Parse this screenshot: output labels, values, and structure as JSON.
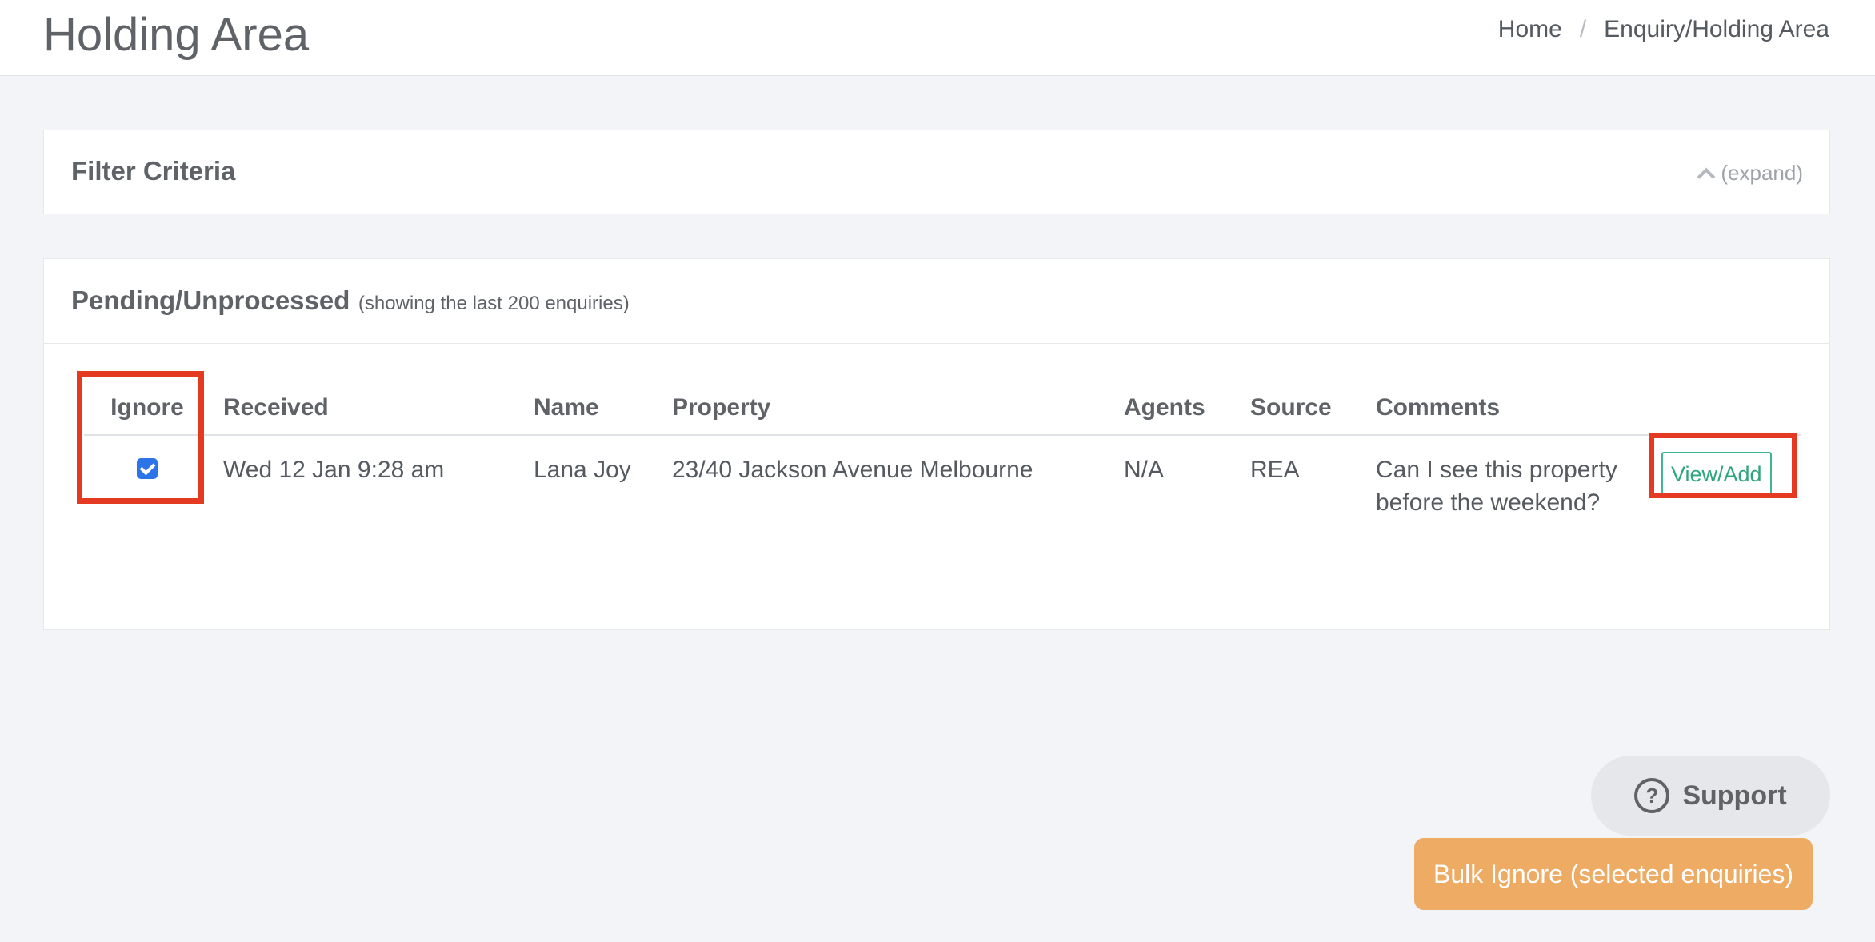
{
  "header": {
    "title": "Holding Area",
    "breadcrumb": [
      "Home",
      "/",
      "Enquiry/Holding Area"
    ]
  },
  "filter": {
    "title": "Filter Criteria",
    "expand_label": "(expand)"
  },
  "pending": {
    "title": "Pending/Unprocessed",
    "subtitle": "(showing the last 200 enquiries)",
    "columns": [
      "Ignore",
      "Received",
      "Name",
      "Property",
      "Agents",
      "Source",
      "Comments"
    ],
    "rows": [
      {
        "ignore_checked": true,
        "received": "Wed 12 Jan 9:28 am",
        "name": "Lana Joy",
        "property": "23/40 Jackson Avenue Melbourne",
        "agents": "N/A",
        "source": "REA",
        "comments": "Can I see this property before the weekend?",
        "action_label": "View/Add"
      }
    ]
  },
  "support": {
    "icon": "question-circle-icon",
    "label": "Support"
  },
  "bulk_ignore": {
    "label": "Bulk Ignore (selected enquiries)"
  },
  "colors": {
    "accent_green": "#3fb892",
    "checkbox_blue": "#2d74e8",
    "highlight_red": "#e43a22",
    "bulk_orange": "#eeab64"
  }
}
